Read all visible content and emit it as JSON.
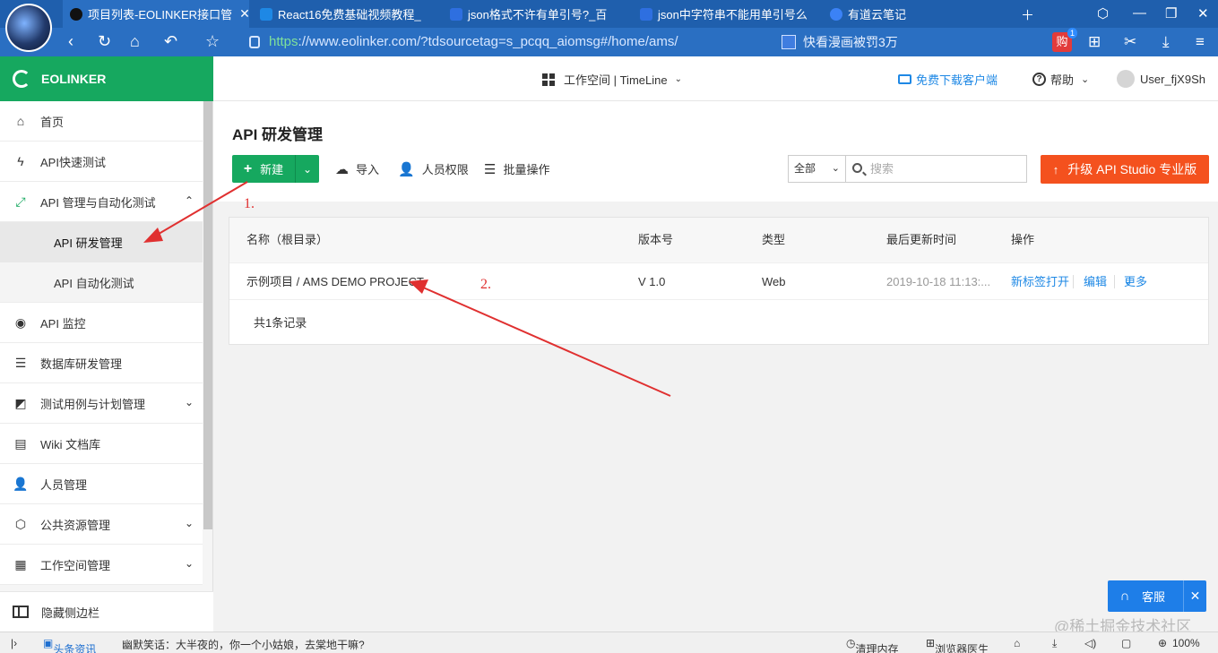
{
  "browser": {
    "tabs": [
      {
        "label": "项目列表-EOLINKER接口管",
        "color": "#111111"
      },
      {
        "label": "React16免费基础视频教程_",
        "color": "#1e88e5"
      },
      {
        "label": "json格式不许有单引号?_百",
        "color": "#2e6fe0"
      },
      {
        "label": "json中字符串不能用单引号么",
        "color": "#2e6fe0"
      },
      {
        "label": "有道云笔记",
        "color": "#3b82f6"
      }
    ],
    "url_scheme": "https",
    "url_rest": "://www.eolinker.com/?tdsourcetag=s_pcqq_aiomsg#/home/ams/",
    "search_text": "快看漫画被罚3万",
    "shop_label": "购",
    "shop_badge": "1"
  },
  "app": {
    "brand": "EOLINKER",
    "workspace": "工作空间 | TimeLine",
    "download_client": "免费下载客户端",
    "help": "帮助",
    "username": "User_fjX9Sh"
  },
  "sidebar": {
    "items": [
      {
        "label": "首页",
        "icon": "home-icon"
      },
      {
        "label": "API快速测试",
        "icon": "bolt-icon"
      },
      {
        "label": "API 管理与自动化测试",
        "icon": "api-icon"
      },
      {
        "label": "API 研发管理",
        "icon": ""
      },
      {
        "label": "API 自动化测试",
        "icon": ""
      },
      {
        "label": "API 监控",
        "icon": "monitor-pin-icon"
      },
      {
        "label": "数据库研发管理",
        "icon": "database-icon"
      },
      {
        "label": "测试用例与计划管理",
        "icon": "test-case-icon"
      },
      {
        "label": "Wiki 文档库",
        "icon": "document-icon"
      },
      {
        "label": "人员管理",
        "icon": "people-icon"
      },
      {
        "label": "公共资源管理",
        "icon": "cube-icon"
      },
      {
        "label": "工作空间管理",
        "icon": "building-icon"
      }
    ],
    "hide_label": "隐藏侧边栏"
  },
  "main": {
    "title": "API 研发管理",
    "new_button": "新建",
    "import_button": "导入",
    "permissions_button": "人员权限",
    "batch_button": "批量操作",
    "scope_value": "全部",
    "search_placeholder": "搜索",
    "upgrade_button": "升级 API Studio 专业版",
    "table": {
      "headers": [
        "名称（根目录）",
        "版本号",
        "类型",
        "最后更新时间",
        "操作"
      ],
      "rows": [
        {
          "name": "示例项目 / AMS DEMO PROJECT",
          "version": "V 1.0",
          "type": "Web",
          "updated": "2019-10-18 11:13:...",
          "actions": [
            "新标签打开",
            "编辑",
            "更多"
          ]
        }
      ],
      "footer": "共1条记录"
    },
    "annotations": [
      "1.",
      "2."
    ]
  },
  "chat_widget": {
    "label": "客服"
  },
  "watermark": "@稀土掘金技术社区",
  "statusbar": {
    "news_label": "头条资讯",
    "ticker": "幽默笑话：大半夜的，你一个小姑娘，去棠地干嘛?",
    "clean_memory": "清理内存",
    "browser_doctor": "浏览器医生",
    "zoom": "100%"
  },
  "colors": {
    "brand_green": "#16a85f",
    "upgrade_orange": "#f4511e",
    "link_blue": "#1e88e5",
    "annotation_red": "#e03030",
    "browser_blue": "#2a6fc2"
  }
}
